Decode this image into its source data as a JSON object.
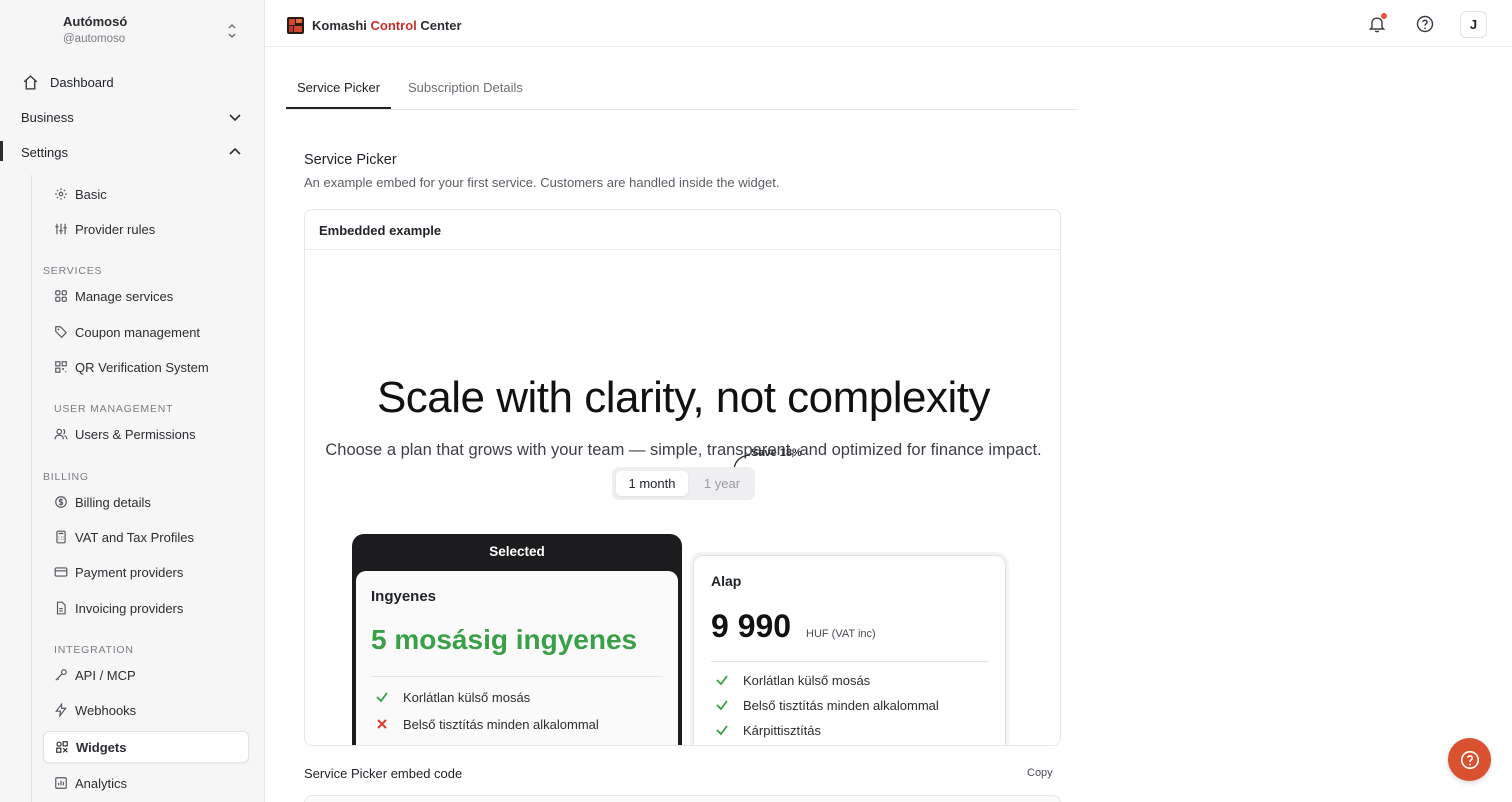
{
  "org": {
    "name": "Autómosó",
    "handle": "@automoso"
  },
  "sidebar": {
    "dashboard": "Dashboard",
    "business": "Business",
    "settings": "Settings",
    "basic": "Basic",
    "provider_rules": "Provider rules",
    "services_head": "SERVICES",
    "manage_services": "Manage services",
    "coupon_management": "Coupon management",
    "qr_verification": "QR Verification System",
    "user_mgmt_head": "USER MANAGEMENT",
    "users_permissions": "Users & Permissions",
    "billing_head": "BILLING",
    "billing_details": "Billing details",
    "vat_tax": "VAT and Tax Profiles",
    "payment_providers": "Payment providers",
    "invoicing_providers": "Invoicing providers",
    "integration_head": "INTEGRATION",
    "api_mcp": "API / MCP",
    "webhooks": "Webhooks",
    "widgets": "Widgets",
    "analytics": "Analytics"
  },
  "header": {
    "brand_a": "Komashi",
    "brand_b": "Control",
    "brand_c": "Center",
    "avatar_letter": "J",
    "accent": "#c8312b"
  },
  "tabs": {
    "service_picker": "Service Picker",
    "subscription_details": "Subscription Details"
  },
  "section": {
    "title": "Service Picker",
    "description": "An example embed for your first service. Customers are handled inside the widget."
  },
  "embed": {
    "card_title": "Embedded example",
    "hero": "Scale with clarity, not complexity",
    "hero_sub": "Choose a plan that grows with your team — simple, transparent, and optimized for finance impact.",
    "save_note": "Save 18%",
    "toggle_month": "1 month",
    "toggle_year": "1 year",
    "selected_label": "Selected",
    "plan_free": {
      "name": "Ingyenes",
      "headline": "5 mosásig ingyenes",
      "features": [
        "Korlátlan külső mosás",
        "Belső tisztítás minden alkalommal"
      ]
    },
    "plan_basic": {
      "name": "Alap",
      "price": "9 990",
      "unit": "HUF (VAT inc)",
      "features": [
        "Korlátlan külső mosás",
        "Belső tisztítás minden alkalommal",
        "Kárpittisztítás"
      ]
    }
  },
  "code": {
    "title": "Service Picker embed code",
    "copy": "Copy"
  }
}
